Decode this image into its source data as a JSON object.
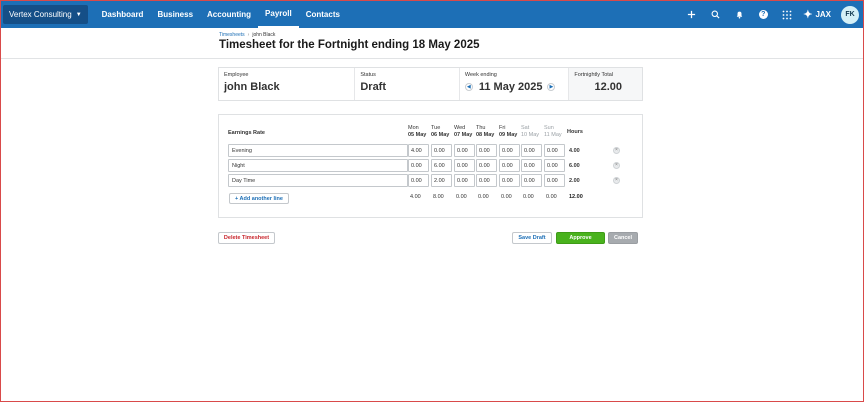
{
  "org": {
    "name": "Vertex Consulting"
  },
  "nav": [
    {
      "label": "Dashboard"
    },
    {
      "label": "Business"
    },
    {
      "label": "Accounting"
    },
    {
      "label": "Payroll"
    },
    {
      "label": "Contacts"
    }
  ],
  "topbar": {
    "jax_label": "JAX",
    "avatar_initials": "FK"
  },
  "breadcrumb": {
    "parent": "Timesheets",
    "current": "john Black"
  },
  "page": {
    "title": "Timesheet for the Fortnight ending 18 May 2025"
  },
  "summary": {
    "employee_label": "Employee",
    "employee_value": "john Black",
    "status_label": "Status",
    "status_value": "Draft",
    "week_label": "Week ending",
    "week_value": "11 May 2025",
    "total_label": "Fortnightly Total",
    "total_value": "12.00"
  },
  "grid": {
    "rate_header": "Earnings Rate",
    "hours_header": "Hours",
    "days": [
      {
        "day": "Mon",
        "date": "05 May"
      },
      {
        "day": "Tue",
        "date": "06 May"
      },
      {
        "day": "Wed",
        "date": "07 May"
      },
      {
        "day": "Thu",
        "date": "08 May"
      },
      {
        "day": "Fri",
        "date": "09 May"
      },
      {
        "day": "Sat",
        "date": "10 May"
      },
      {
        "day": "Sun",
        "date": "11 May"
      }
    ],
    "rows": [
      {
        "rate": "Evening",
        "values": [
          "4.00",
          "0.00",
          "0.00",
          "0.00",
          "0.00",
          "0.00",
          "0.00"
        ],
        "hours": "4.00"
      },
      {
        "rate": "Night",
        "values": [
          "0.00",
          "6.00",
          "0.00",
          "0.00",
          "0.00",
          "0.00",
          "0.00"
        ],
        "hours": "6.00"
      },
      {
        "rate": "Day Time",
        "values": [
          "0.00",
          "2.00",
          "0.00",
          "0.00",
          "0.00",
          "0.00",
          "0.00"
        ],
        "hours": "2.00"
      }
    ],
    "add_line_label": "+ Add another line",
    "totals": [
      "4.00",
      "8.00",
      "0.00",
      "0.00",
      "0.00",
      "0.00",
      "0.00"
    ],
    "grand_total": "12.00"
  },
  "actions": {
    "delete_label": "Delete Timesheet",
    "save_label": "Save Draft",
    "approve_label": "Approve",
    "cancel_label": "Cancel"
  },
  "colors": {
    "topbar": "#1d6fb6",
    "approve": "#49b21d",
    "delete_text": "#c8252c",
    "cancel": "#a7abaf"
  }
}
